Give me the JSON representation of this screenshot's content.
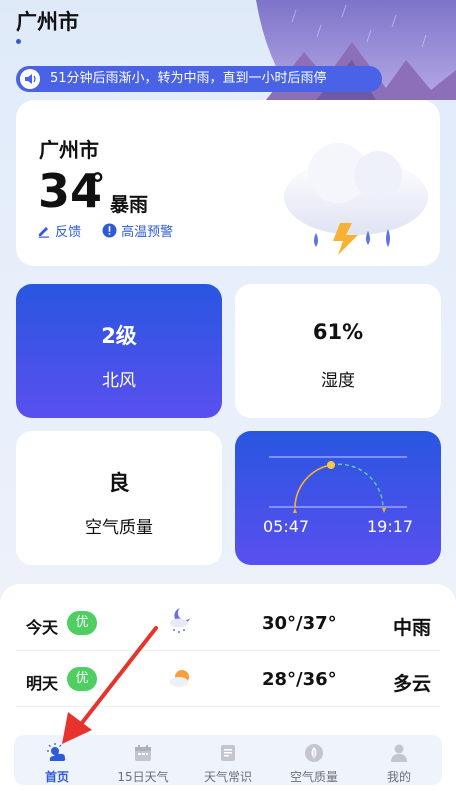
{
  "header": {
    "city": "广州市"
  },
  "banner": {
    "text": "51分钟后雨渐小，转为中雨，直到一小时后雨停"
  },
  "current": {
    "city": "广州市",
    "temp": "34",
    "degree": "°",
    "condition": "暴雨",
    "feedback_label": "反馈",
    "warning_label": "高温预警"
  },
  "tiles": {
    "wind": {
      "value": "2级",
      "label": "北风"
    },
    "humidity": {
      "value": "61%",
      "label": "湿度"
    },
    "air": {
      "value": "良",
      "label": "空气质量"
    },
    "sun": {
      "sunrise": "05:47",
      "sunset": "19:17"
    }
  },
  "forecast": [
    {
      "day": "今天",
      "aqi": "优",
      "temp": "30°/37°",
      "condition": "中雨",
      "icon": "rain-moon-icon"
    },
    {
      "day": "明天",
      "aqi": "优",
      "temp": "28°/36°",
      "condition": "多云",
      "icon": "cloudy-sun-icon"
    }
  ],
  "tabs": [
    {
      "label": "首页",
      "icon": "home-weather-icon",
      "active": true
    },
    {
      "label": "15日天气",
      "icon": "calendar-icon",
      "active": false
    },
    {
      "label": "天气常识",
      "icon": "book-icon",
      "active": false
    },
    {
      "label": "空气质量",
      "icon": "leaf-icon",
      "active": false
    },
    {
      "label": "我的",
      "icon": "person-icon",
      "active": false
    }
  ],
  "colors": {
    "accent": "#2f5bd8",
    "badge": "#4fcf62",
    "annotation_arrow": "#e8322c"
  }
}
